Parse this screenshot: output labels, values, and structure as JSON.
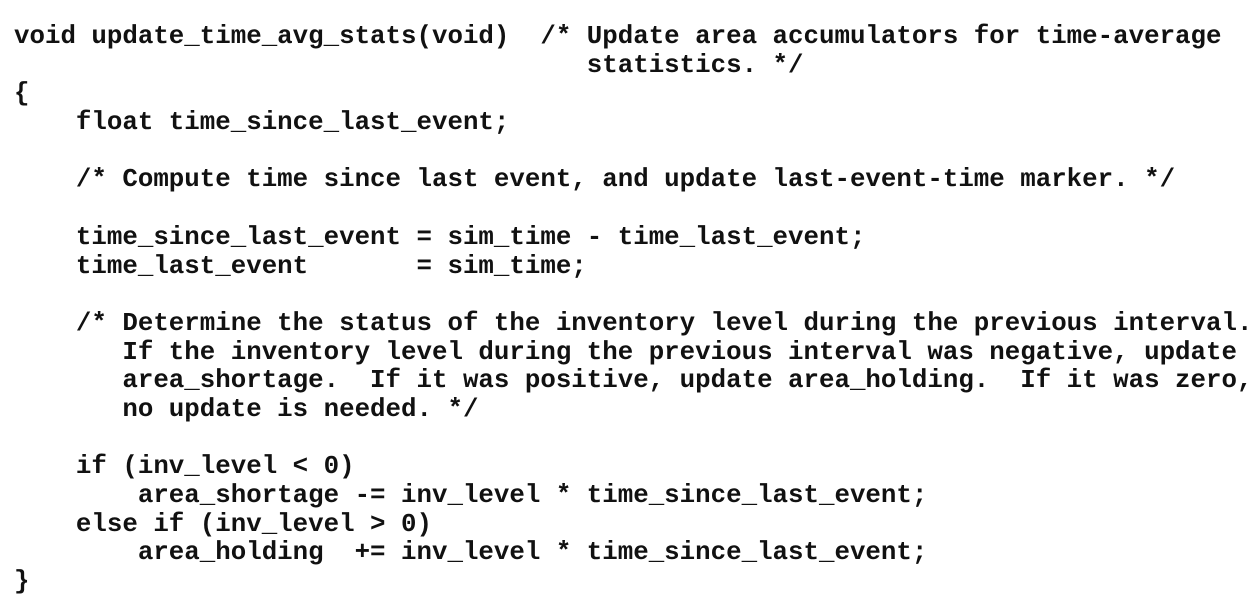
{
  "code": {
    "lines": [
      "void update_time_avg_stats(void)  /* Update area accumulators for time-average",
      "                                     statistics. */",
      "{",
      "    float time_since_last_event;",
      "",
      "    /* Compute time since last event, and update last-event-time marker. */",
      "",
      "    time_since_last_event = sim_time - time_last_event;",
      "    time_last_event       = sim_time;",
      "",
      "    /* Determine the status of the inventory level during the previous interval.",
      "       If the inventory level during the previous interval was negative, update",
      "       area_shortage.  If it was positive, update area_holding.  If it was zero,",
      "       no update is needed. */",
      "",
      "    if (inv_level < 0)",
      "        area_shortage -= inv_level * time_since_last_event;",
      "    else if (inv_level > 0)",
      "        area_holding  += inv_level * time_since_last_event;",
      "}"
    ]
  }
}
